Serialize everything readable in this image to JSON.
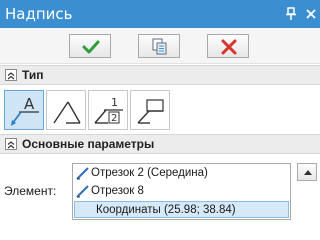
{
  "window": {
    "title": "Надпись",
    "pin_icon": "pin-icon",
    "close_icon": "close-icon",
    "title_bar_color": "#3b8fd1"
  },
  "actions": {
    "ok_icon": "checkmark-icon",
    "copy_icon": "copy-document-icon",
    "cancel_icon": "x-cancel-icon",
    "ok_color": "#2e9d3b",
    "cancel_color": "#d9322b"
  },
  "sections": {
    "type": {
      "label": "Тип",
      "expanded": true,
      "tools": [
        {
          "icon": "leader-text-icon",
          "active": true
        },
        {
          "icon": "angle-leader-icon",
          "active": false
        },
        {
          "icon": "fraction-leader-icon",
          "active": false
        },
        {
          "icon": "box-leader-icon",
          "active": false
        }
      ]
    },
    "main": {
      "label": "Основные параметры",
      "expanded": true,
      "element_label": "Элемент:",
      "element_items": [
        {
          "text": "Отрезок 2 (Середина)",
          "icon": "line-segment-icon",
          "selected": false
        },
        {
          "text": "Отрезок 8",
          "icon": "line-segment-icon",
          "selected": false
        },
        {
          "text": "Координаты (25.98; 38.84)",
          "icon": "",
          "selected": true
        }
      ]
    }
  }
}
